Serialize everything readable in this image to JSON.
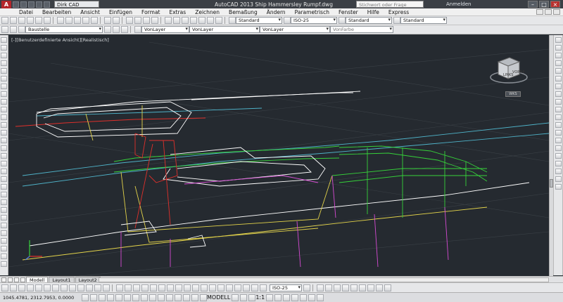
{
  "titlebar": {
    "app_icon_label": "A",
    "workspace": "Dirk CAD",
    "title": "AutoCAD 2013    Ship Hammersley Rumpf.dwg",
    "search_placeholder": "Stichwort oder Frage eingeben",
    "login": "Anmelden"
  },
  "menu": [
    "Datei",
    "Bearbeiten",
    "Ansicht",
    "Einfügen",
    "Format",
    "Extras",
    "Zeichnen",
    "Bemaßung",
    "Ändern",
    "Parametrisch",
    "Fenster",
    "Hilfe",
    "Express"
  ],
  "toolbar1": {
    "text_style": "Standard",
    "dim_style": "ISO-25",
    "table_style": "Standard",
    "multileader_style": "Standard"
  },
  "toolbar2": {
    "layer": "Baustelle",
    "color": "VonLayer",
    "linetype": "VonLayer",
    "lineweight": "VonLayer",
    "plotstyle": "VonFarbe"
  },
  "viewport": {
    "label": "[-][Benutzerdefinierte Ansicht][Realistisch]",
    "viewcube_left": "LINKS",
    "viewcube_front": "VORNE",
    "wcs": "WKS"
  },
  "tabs": [
    "Modell",
    "Layout1",
    "Layout2"
  ],
  "status": {
    "anno_scale": "ISO-25",
    "model": "MODELL",
    "scale": "1:1"
  },
  "coordinates": "1045.4781, 2312.7953, 0.0000"
}
